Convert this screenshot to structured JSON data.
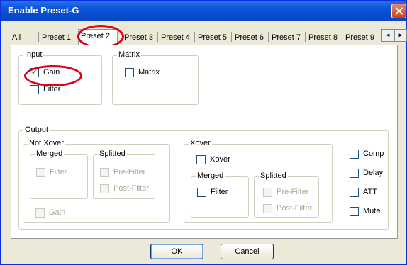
{
  "window": {
    "title": "Enable Preset-G"
  },
  "tabs": [
    "All",
    "Preset 1",
    "Preset 2",
    "Preset 3",
    "Preset 4",
    "Preset 5",
    "Preset 6",
    "Preset 7",
    "Preset 8",
    "Preset 9"
  ],
  "active_tab": "Preset 2",
  "tab_scroll": {
    "left": "◄",
    "right": "►"
  },
  "input": {
    "label": "Input",
    "gain": {
      "label": "Gain",
      "checked": true
    },
    "filter": {
      "label": "Filter",
      "checked": false
    }
  },
  "matrix": {
    "label": "Matrix",
    "matrix": {
      "label": "Matrix",
      "checked": false
    }
  },
  "output": {
    "label": "Output",
    "not_xover": {
      "label": "Not Xover",
      "merged": {
        "label": "Merged",
        "filter": "Filter"
      },
      "splitted": {
        "label": "Splitted",
        "pre_filter": "Pre-Filter",
        "post_filter": "Post-Filter"
      },
      "gain": "Gain"
    },
    "xover": {
      "label": "Xover",
      "xover": "Xover",
      "merged": {
        "label": "Merged",
        "filter": "Filter"
      },
      "splitted": {
        "label": "Splitted",
        "pre_filter": "Pre-Filter",
        "post_filter": "Post-Filter"
      }
    },
    "comp": "Comp",
    "delay": "Delay",
    "att": "ATT",
    "mute": "Mute"
  },
  "buttons": {
    "ok": "OK",
    "cancel": "Cancel"
  },
  "colors": {
    "title_bar": "#0a53d8",
    "annotation": "#e0001b",
    "check_tick": "#21a121"
  }
}
